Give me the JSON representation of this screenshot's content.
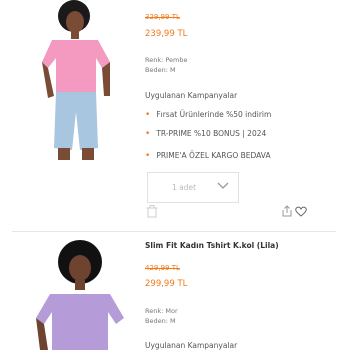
{
  "products": [
    {
      "title": "",
      "old_price": "329,99 TL",
      "price": "239,99 TL",
      "color": "Renk: Pembe",
      "size": "Beden: M",
      "campaigns_title": "Uygulanan Kampanyalar",
      "campaigns": [
        "Fırsat Ürünlerinde %50 indirim",
        "TR-PRIME %10 BONUS | 2024",
        "PRIME'A ÖZEL KARGO BEDAVA"
      ],
      "quantity_label": "1 adet"
    },
    {
      "title": "Slim Fit Kadın Tshirt K.kol (Lila)",
      "old_price": "429,99 TL",
      "price": "299,99 TL",
      "color": "Renk: Mor",
      "size": "Beden: M",
      "campaigns_title": "Uygulanan Kampanyalar"
    }
  ],
  "colors": {
    "accent": "#f27a1a",
    "muted": "#bbbbbb"
  },
  "icons": [
    "trash-icon",
    "share-icon",
    "heart-icon",
    "chevron-down-icon"
  ]
}
